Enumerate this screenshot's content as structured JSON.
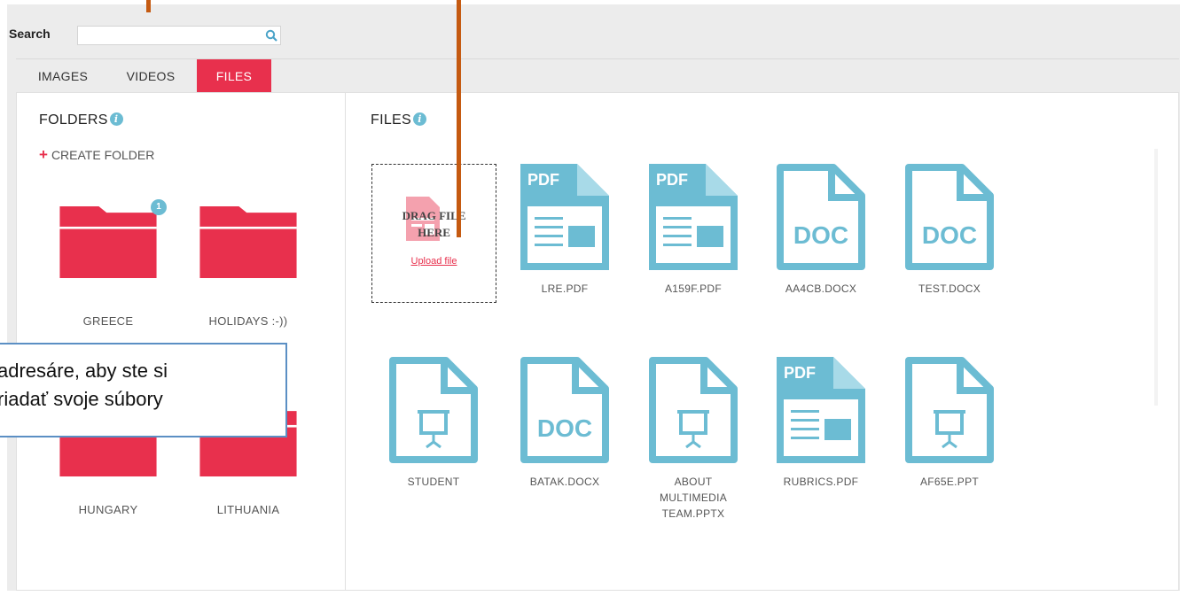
{
  "search": {
    "label": "Search",
    "value": "",
    "placeholder": ""
  },
  "tabs": [
    {
      "label": "IMAGES",
      "active": false
    },
    {
      "label": "VIDEOS",
      "active": false
    },
    {
      "label": "FILES",
      "active": true
    }
  ],
  "folders_panel": {
    "title": "FOLDERS",
    "create_label": "CREATE FOLDER",
    "folders": [
      {
        "name": "GREECE",
        "badge": "1"
      },
      {
        "name": "HOLIDAYS :-))",
        "badge": ""
      },
      {
        "name": "HUNGARY",
        "badge": ""
      },
      {
        "name": "LITHUANIA",
        "badge": ""
      }
    ]
  },
  "files_panel": {
    "title": "FILES",
    "dropzone": {
      "line1": "DRAG FILE",
      "line2": "HERE",
      "upload_link": "Upload file"
    },
    "files": [
      {
        "name": "LRE.PDF",
        "icon": "pdf-file-icon",
        "tag": "PDF"
      },
      {
        "name": "A159F.PDF",
        "icon": "pdf-file-icon",
        "tag": "PDF"
      },
      {
        "name": "AA4CB.DOCX",
        "icon": "doc-file-icon",
        "tag": "DOC"
      },
      {
        "name": "TEST.DOCX",
        "icon": "doc-file-icon",
        "tag": "DOC"
      },
      {
        "name": "STUDENT",
        "icon": "presentation-file-icon",
        "tag": ""
      },
      {
        "name": "BATAK.DOCX",
        "icon": "doc-file-icon",
        "tag": "DOC"
      },
      {
        "name": "ABOUT MULTIMEDIA TEAM.PPTX",
        "icon": "presentation-file-icon",
        "tag": ""
      },
      {
        "name": "RUBRICS.PDF",
        "icon": "pdf-file-icon",
        "tag": "PDF"
      },
      {
        "name": "AF65E.PPT",
        "icon": "presentation-file-icon",
        "tag": ""
      }
    ]
  },
  "callout": {
    "line1": "adresáre, aby ste si",
    "line2": "riadať svoje súbory"
  },
  "colors": {
    "accent": "#e8304d",
    "file_icon": "#6cbcd3",
    "pointer": "#c55a11",
    "callout_border": "#5b8fc4"
  }
}
